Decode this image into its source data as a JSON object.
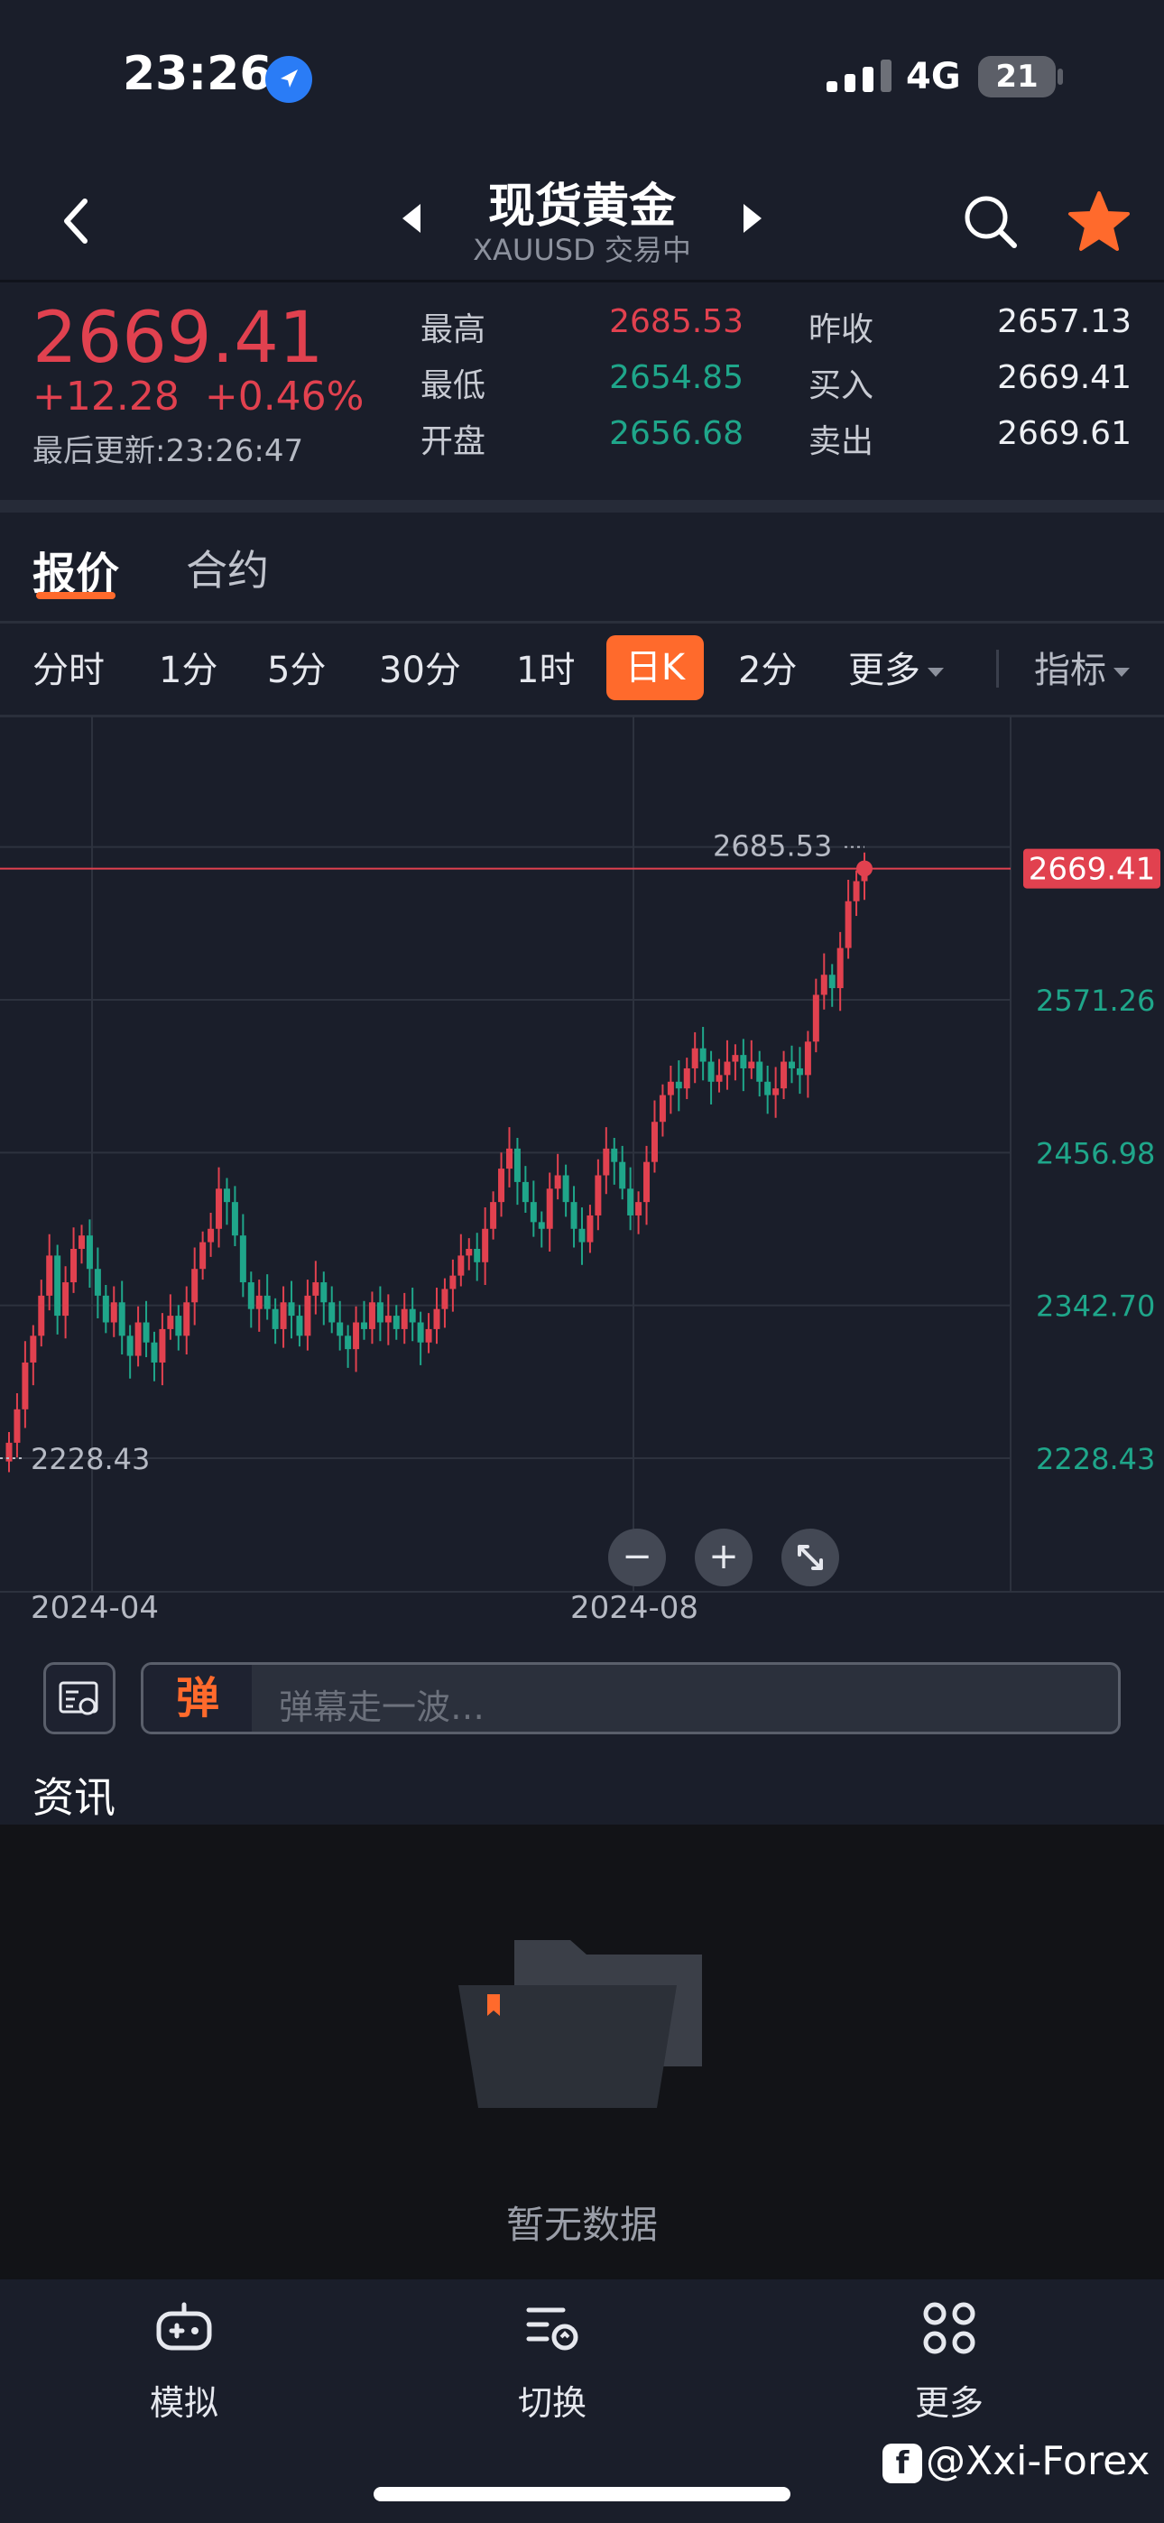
{
  "status_bar": {
    "time": "23:26",
    "network": "4G",
    "battery": "21"
  },
  "header": {
    "title": "现货黄金",
    "subtitle": "XAUUSD 交易中"
  },
  "quote": {
    "price": "2669.41",
    "change": "+12.28",
    "change_pct": "+0.46%",
    "updated": "最后更新:23:26:47",
    "stats": [
      {
        "label": "最高",
        "value": "2685.53"
      },
      {
        "label": "最低",
        "value": "2654.85"
      },
      {
        "label": "开盘",
        "value": "2656.68"
      },
      {
        "label": "昨收",
        "value": "2657.13"
      },
      {
        "label": "买入",
        "value": "2669.41"
      },
      {
        "label": "卖出",
        "value": "2669.61"
      }
    ]
  },
  "tabs": {
    "active": "报价",
    "other": "合约"
  },
  "periods": [
    "分时",
    "1分",
    "5分",
    "30分",
    "1时",
    "日K",
    "2分",
    "更多",
    "指标"
  ],
  "colors": {
    "up": "#e1414f",
    "down": "#1fa68a",
    "accent": "#ff6a2c"
  },
  "chart_data": {
    "type": "candlestick",
    "y_ticks": [
      "2571.26",
      "2456.98",
      "2342.70",
      "2228.43"
    ],
    "current_price": "2669.41",
    "max_label": "2685.53",
    "min_label": "2228.43",
    "x_ticks": [
      "2024-04",
      "2024-08"
    ],
    "closes": [
      2240,
      2265,
      2300,
      2320,
      2350,
      2380,
      2335,
      2360,
      2385,
      2395,
      2370,
      2350,
      2330,
      2345,
      2320,
      2305,
      2330,
      2315,
      2300,
      2325,
      2335,
      2320,
      2345,
      2370,
      2390,
      2400,
      2430,
      2420,
      2395,
      2360,
      2340,
      2350,
      2340,
      2325,
      2345,
      2335,
      2320,
      2350,
      2360,
      2345,
      2330,
      2320,
      2310,
      2330,
      2325,
      2345,
      2330,
      2335,
      2325,
      2340,
      2330,
      2315,
      2325,
      2340,
      2355,
      2365,
      2380,
      2385,
      2375,
      2400,
      2420,
      2445,
      2460,
      2435,
      2420,
      2405,
      2400,
      2430,
      2440,
      2420,
      2400,
      2390,
      2410,
      2440,
      2460,
      2450,
      2430,
      2410,
      2420,
      2450,
      2480,
      2500,
      2510,
      2505,
      2520,
      2535,
      2525,
      2510,
      2515,
      2525,
      2530,
      2520,
      2525,
      2510,
      2500,
      2505,
      2525,
      2520,
      2515,
      2540,
      2575,
      2590,
      2580,
      2610,
      2645,
      2660,
      2669.41
    ]
  },
  "zoom": {
    "minus": "−",
    "plus": "+"
  },
  "comment": {
    "tag": "弹",
    "placeholder": "弹幕走一波…"
  },
  "news": {
    "title": "资讯",
    "empty": "暂无数据"
  },
  "bottom_nav": [
    {
      "label": "模拟",
      "icon": "gamepad-icon"
    },
    {
      "label": "切换",
      "icon": "switch-icon"
    },
    {
      "label": "更多",
      "icon": "more-grid-icon"
    }
  ],
  "watermark": "@Xxi-Forex"
}
